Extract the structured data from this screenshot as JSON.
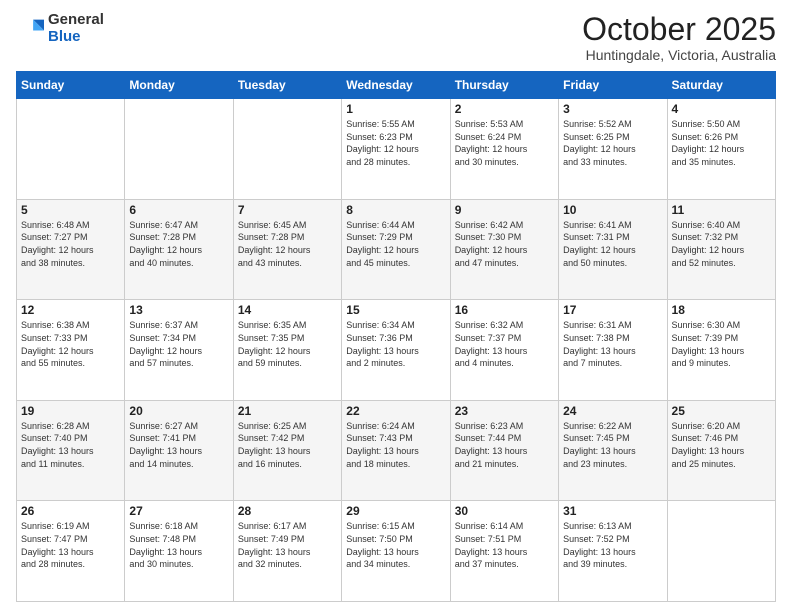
{
  "header": {
    "logo": {
      "general": "General",
      "blue": "Blue"
    },
    "title": "October 2025",
    "subtitle": "Huntingdale, Victoria, Australia"
  },
  "calendar": {
    "days_of_week": [
      "Sunday",
      "Monday",
      "Tuesday",
      "Wednesday",
      "Thursday",
      "Friday",
      "Saturday"
    ],
    "weeks": [
      [
        {
          "day": "",
          "info": ""
        },
        {
          "day": "",
          "info": ""
        },
        {
          "day": "",
          "info": ""
        },
        {
          "day": "1",
          "info": "Sunrise: 5:55 AM\nSunset: 6:23 PM\nDaylight: 12 hours\nand 28 minutes."
        },
        {
          "day": "2",
          "info": "Sunrise: 5:53 AM\nSunset: 6:24 PM\nDaylight: 12 hours\nand 30 minutes."
        },
        {
          "day": "3",
          "info": "Sunrise: 5:52 AM\nSunset: 6:25 PM\nDaylight: 12 hours\nand 33 minutes."
        },
        {
          "day": "4",
          "info": "Sunrise: 5:50 AM\nSunset: 6:26 PM\nDaylight: 12 hours\nand 35 minutes."
        }
      ],
      [
        {
          "day": "5",
          "info": "Sunrise: 6:48 AM\nSunset: 7:27 PM\nDaylight: 12 hours\nand 38 minutes."
        },
        {
          "day": "6",
          "info": "Sunrise: 6:47 AM\nSunset: 7:28 PM\nDaylight: 12 hours\nand 40 minutes."
        },
        {
          "day": "7",
          "info": "Sunrise: 6:45 AM\nSunset: 7:28 PM\nDaylight: 12 hours\nand 43 minutes."
        },
        {
          "day": "8",
          "info": "Sunrise: 6:44 AM\nSunset: 7:29 PM\nDaylight: 12 hours\nand 45 minutes."
        },
        {
          "day": "9",
          "info": "Sunrise: 6:42 AM\nSunset: 7:30 PM\nDaylight: 12 hours\nand 47 minutes."
        },
        {
          "day": "10",
          "info": "Sunrise: 6:41 AM\nSunset: 7:31 PM\nDaylight: 12 hours\nand 50 minutes."
        },
        {
          "day": "11",
          "info": "Sunrise: 6:40 AM\nSunset: 7:32 PM\nDaylight: 12 hours\nand 52 minutes."
        }
      ],
      [
        {
          "day": "12",
          "info": "Sunrise: 6:38 AM\nSunset: 7:33 PM\nDaylight: 12 hours\nand 55 minutes."
        },
        {
          "day": "13",
          "info": "Sunrise: 6:37 AM\nSunset: 7:34 PM\nDaylight: 12 hours\nand 57 minutes."
        },
        {
          "day": "14",
          "info": "Sunrise: 6:35 AM\nSunset: 7:35 PM\nDaylight: 12 hours\nand 59 minutes."
        },
        {
          "day": "15",
          "info": "Sunrise: 6:34 AM\nSunset: 7:36 PM\nDaylight: 13 hours\nand 2 minutes."
        },
        {
          "day": "16",
          "info": "Sunrise: 6:32 AM\nSunset: 7:37 PM\nDaylight: 13 hours\nand 4 minutes."
        },
        {
          "day": "17",
          "info": "Sunrise: 6:31 AM\nSunset: 7:38 PM\nDaylight: 13 hours\nand 7 minutes."
        },
        {
          "day": "18",
          "info": "Sunrise: 6:30 AM\nSunset: 7:39 PM\nDaylight: 13 hours\nand 9 minutes."
        }
      ],
      [
        {
          "day": "19",
          "info": "Sunrise: 6:28 AM\nSunset: 7:40 PM\nDaylight: 13 hours\nand 11 minutes."
        },
        {
          "day": "20",
          "info": "Sunrise: 6:27 AM\nSunset: 7:41 PM\nDaylight: 13 hours\nand 14 minutes."
        },
        {
          "day": "21",
          "info": "Sunrise: 6:25 AM\nSunset: 7:42 PM\nDaylight: 13 hours\nand 16 minutes."
        },
        {
          "day": "22",
          "info": "Sunrise: 6:24 AM\nSunset: 7:43 PM\nDaylight: 13 hours\nand 18 minutes."
        },
        {
          "day": "23",
          "info": "Sunrise: 6:23 AM\nSunset: 7:44 PM\nDaylight: 13 hours\nand 21 minutes."
        },
        {
          "day": "24",
          "info": "Sunrise: 6:22 AM\nSunset: 7:45 PM\nDaylight: 13 hours\nand 23 minutes."
        },
        {
          "day": "25",
          "info": "Sunrise: 6:20 AM\nSunset: 7:46 PM\nDaylight: 13 hours\nand 25 minutes."
        }
      ],
      [
        {
          "day": "26",
          "info": "Sunrise: 6:19 AM\nSunset: 7:47 PM\nDaylight: 13 hours\nand 28 minutes."
        },
        {
          "day": "27",
          "info": "Sunrise: 6:18 AM\nSunset: 7:48 PM\nDaylight: 13 hours\nand 30 minutes."
        },
        {
          "day": "28",
          "info": "Sunrise: 6:17 AM\nSunset: 7:49 PM\nDaylight: 13 hours\nand 32 minutes."
        },
        {
          "day": "29",
          "info": "Sunrise: 6:15 AM\nSunset: 7:50 PM\nDaylight: 13 hours\nand 34 minutes."
        },
        {
          "day": "30",
          "info": "Sunrise: 6:14 AM\nSunset: 7:51 PM\nDaylight: 13 hours\nand 37 minutes."
        },
        {
          "day": "31",
          "info": "Sunrise: 6:13 AM\nSunset: 7:52 PM\nDaylight: 13 hours\nand 39 minutes."
        },
        {
          "day": "",
          "info": ""
        }
      ]
    ]
  }
}
